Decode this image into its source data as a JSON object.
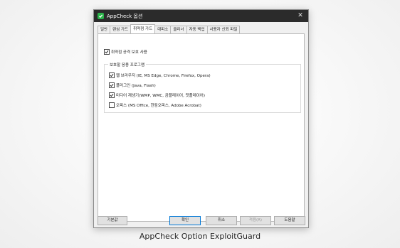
{
  "window": {
    "title": "AppCheck 옵션",
    "close_glyph": "✕",
    "accent_color": "#2bb34a"
  },
  "tabs": [
    {
      "label": "일반"
    },
    {
      "label": "랜섬 가드"
    },
    {
      "label": "취약점 가드"
    },
    {
      "label": "대피소"
    },
    {
      "label": "클리너"
    },
    {
      "label": "자동 백업"
    },
    {
      "label": "사용자 신뢰 파일"
    }
  ],
  "exploit_guard": {
    "enable_label": "취약점 공격 보호 사용",
    "enable_checked": true,
    "group_title": "보호할 응용 프로그램",
    "apps": [
      {
        "label": "웹 브라우저 (IE, MS Edge, Chrome, Firefox, Opera)",
        "checked": true
      },
      {
        "label": "플러그인 (Java, Flash)",
        "checked": true
      },
      {
        "label": "미디어 재생기(WMP, WMC, 곰플레이어, 팟플레이어)",
        "checked": true
      },
      {
        "label": "오피스 (MS Office, 한컴오피스, Adobe Acrobat)",
        "checked": false
      }
    ]
  },
  "buttons": {
    "defaults": "기본값",
    "ok": "확인",
    "cancel": "취소",
    "apply": "적용(A)",
    "help": "도움말"
  },
  "caption": "AppCheck Option ExploitGuard"
}
